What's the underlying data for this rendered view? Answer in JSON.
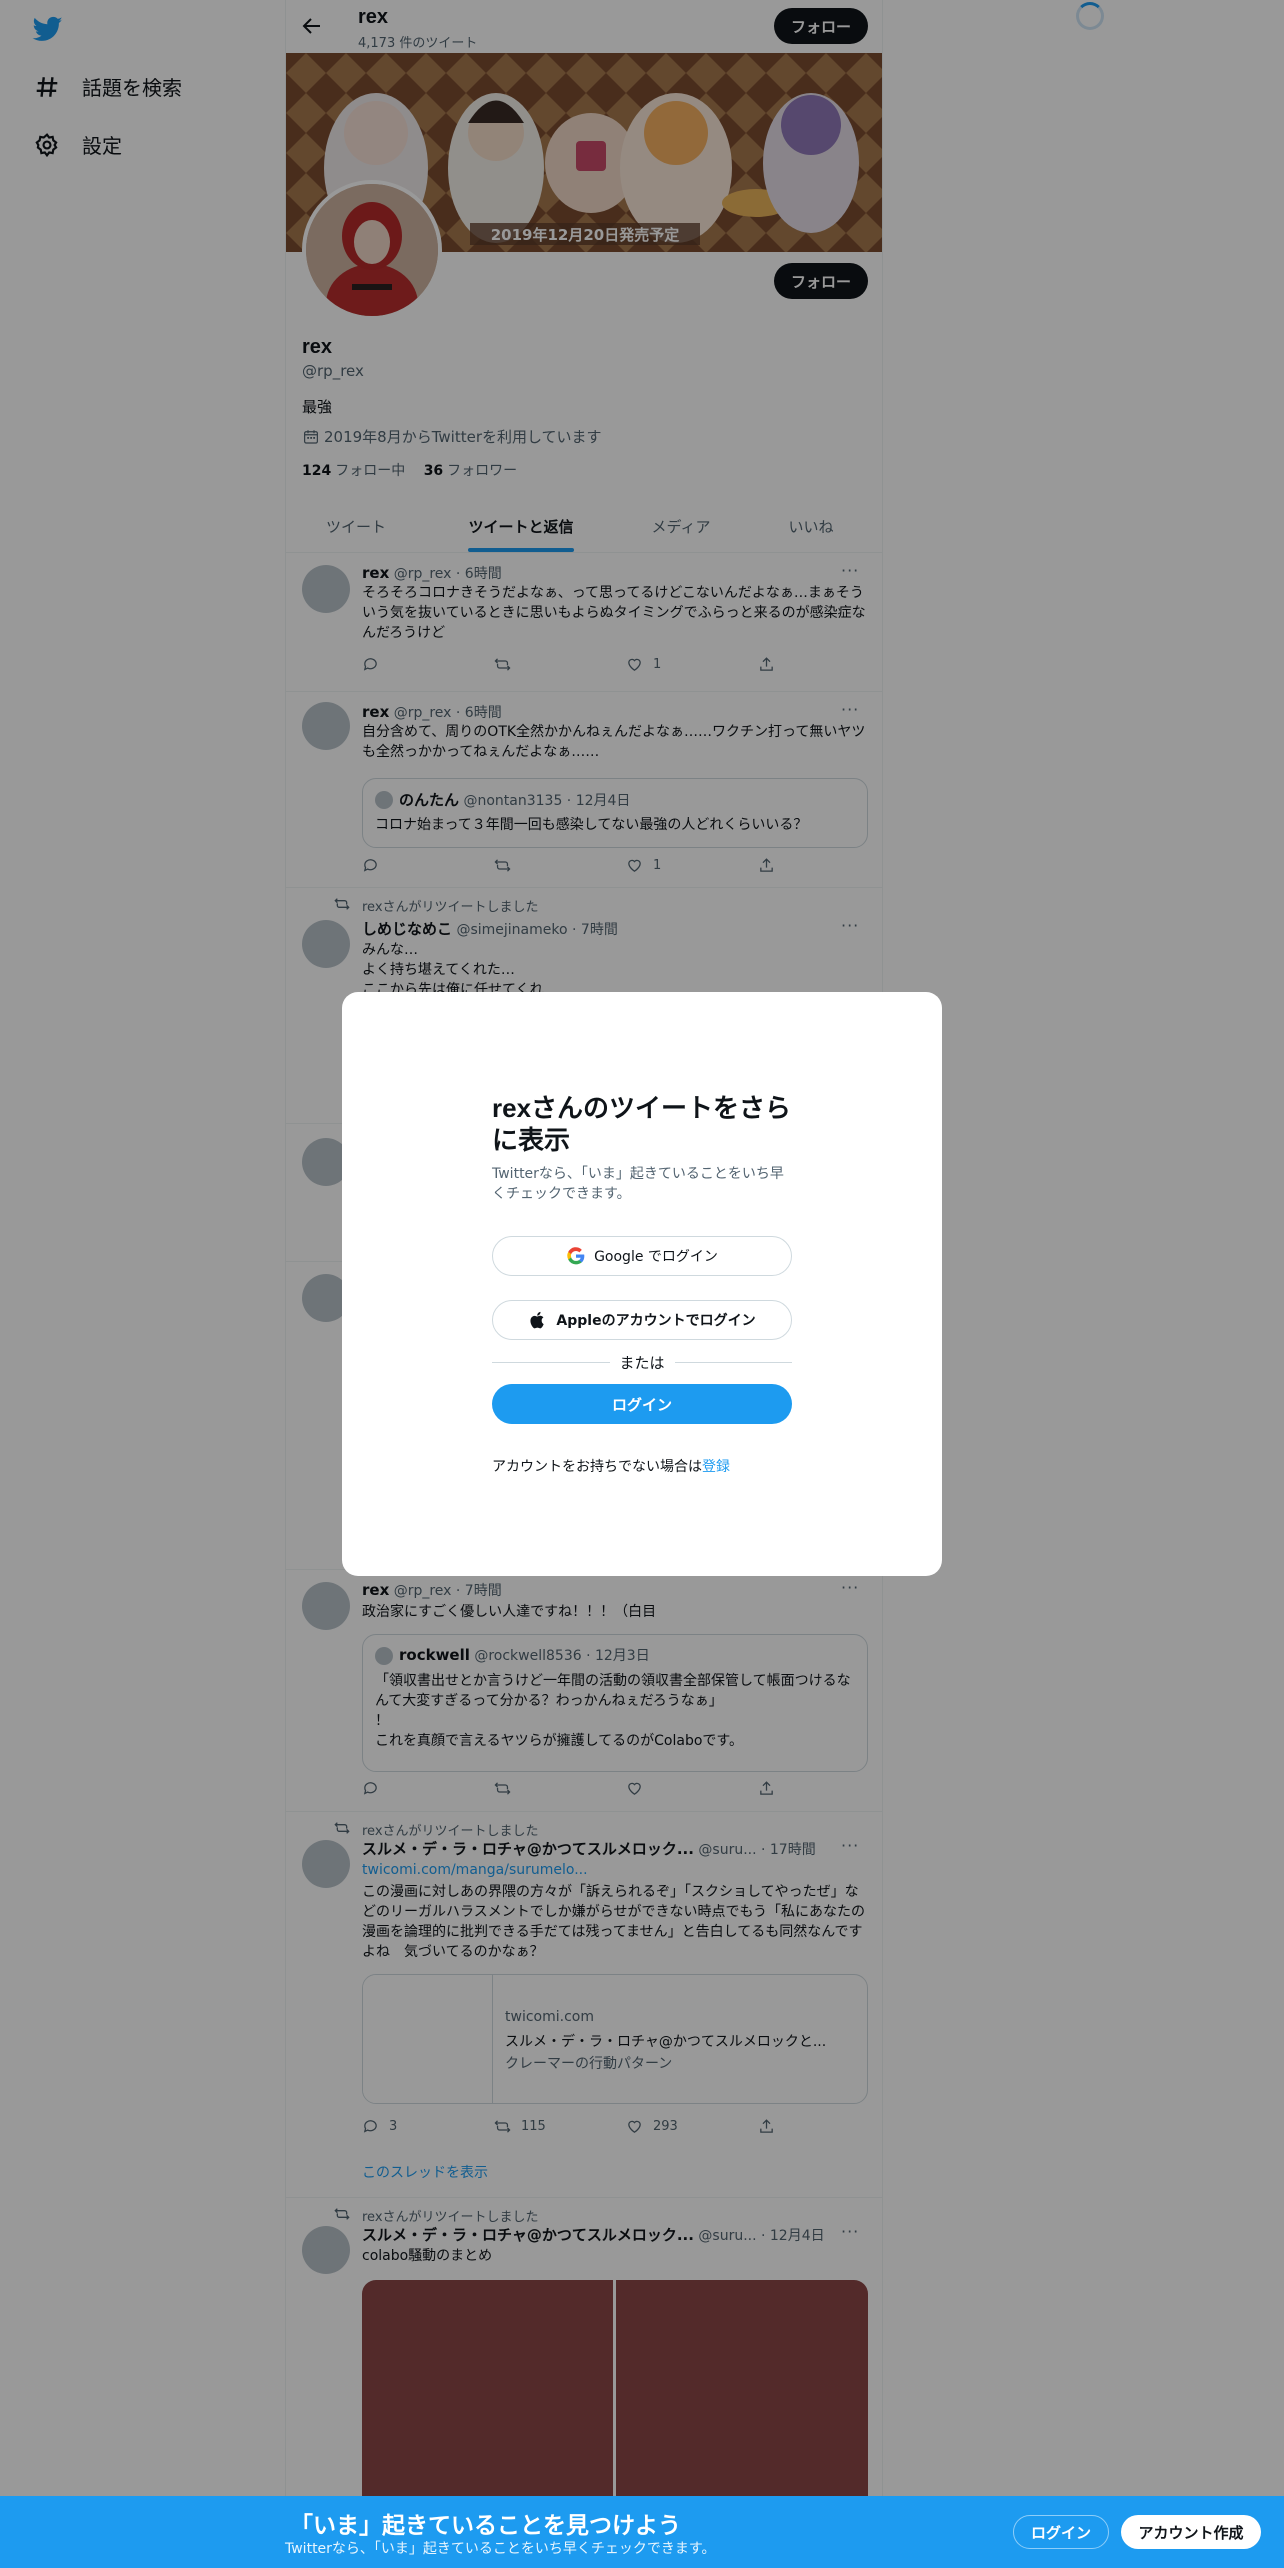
{
  "nav": {
    "explore_label": "話題を検索",
    "settings_label": "設定"
  },
  "header": {
    "title": "rex",
    "tweet_count": "4,173 件のツイート",
    "follow_label": "フォロー"
  },
  "banner": {
    "caption": "2019年12月20日発売予定"
  },
  "profile": {
    "name": "rex",
    "handle": "@rp_rex",
    "bio": "最強",
    "joined": "2019年8月からTwitterを利用しています",
    "following_count": "124",
    "following_label": "フォロー中",
    "followers_count": "36",
    "followers_label": "フォロワー",
    "follow_label": "フォロー"
  },
  "tabs": [
    "ツイート",
    "ツイートと返信",
    "メディア",
    "いいね"
  ],
  "tweets": [
    {
      "name": "rex",
      "meta": "@rp_rex · 6時間",
      "text": "そろそろコロナきそうだよなぁ、って思ってるけどこないんだよなぁ…まぁそういう気を抜いているときに思いもよらぬタイミングでふらっと来るのが感染症なんだろうけど",
      "reply": "",
      "retweet": "",
      "like": "1"
    },
    {
      "name": "rex",
      "meta": "@rp_rex · 6時間",
      "text": "自分含めて、周りのOTK全然かかんねぇんだよなぁ……ワクチン打って無いヤツも全然っかかってねぇんだよなぁ……",
      "quote": {
        "name": "のんたん",
        "meta": "@nontan3135 · 12月4日",
        "text": "コロナ始まって３年間一回も感染してない最強の人どれくらいいる？"
      },
      "reply": "",
      "retweet": "",
      "like": "1"
    },
    {
      "retweet_label": "rexさんがリツイートしました",
      "name": "しめじなめこ",
      "meta": "@simejinameko · 7時間",
      "text": "みんな…\nよく持ち堪えてくれた…\nここから先は俺に任せてくれ"
    },
    {
      "name": "rex",
      "meta": "@rp_rex · 7時間",
      "text": "政治家にすごく優しい人達ですね！！！（白目",
      "quote": {
        "name": "rockwell",
        "meta": "@rockwell8536 · 12月3日",
        "text": "「領収書出せとか言うけど一年間の活動の領収書全部保管して帳面つけるなんて大変すぎるって分かる？わっかんねぇだろうなぁ」\n！\nこれを真顔で言えるヤツらが擁護してるのがColaboです。"
      },
      "reply": "",
      "retweet": "",
      "like": ""
    },
    {
      "retweet_label": "rexさんがリツイートしました",
      "name": "スルメ・デ・ラ・ロチャ@かつてスルメロック...",
      "meta": "@suru... · 17時間",
      "link": "twicomi.com/manga/surumelo...",
      "text": "この漫画に対しあの界隈の方々が「訴えられるぞ」「スクショしてやったぜ」などのリーガルハラスメントでしか嫌がらせができない時点でもう「私にあなたの漫画を論理的に批判できる手だては残ってません」と告白してるも同然なんですよね　気づいてるのかなぁ？",
      "card": {
        "domain": "twicomi.com",
        "title": "スルメ・デ・ラ・ロチャ@かつてスルメロックと...",
        "desc": "クレーマーの行動パターン"
      },
      "reply": "3",
      "retweet": "115",
      "like": "293",
      "thread_label": "このスレッドを表示"
    },
    {
      "retweet_label": "rexさんがリツイートしました",
      "name": "スルメ・デ・ラ・ロチャ@かつてスルメロック...",
      "meta": "@suru... · 12月4日",
      "text": "colabo騒動のまとめ"
    }
  ],
  "modal": {
    "title": "rexさんのツイートをさらに表示",
    "subtitle": "Twitterなら、「いま」起きていることをいち早くチェックできます。",
    "google_label": "Google でログイン",
    "apple_label": "Appleのアカウントでログイン",
    "or_label": "または",
    "login_label": "ログイン",
    "signup_prompt": "アカウントをお持ちでない場合は",
    "signup_link": "登録"
  },
  "bottom_bar": {
    "title": "「いま」起きていることを見つけよう",
    "subtitle": "Twitterなら、「いま」起きていることをいち早くチェックできます。",
    "login_label": "ログイン",
    "signup_label": "アカウント作成"
  },
  "colors": {
    "accent": "#1d9bf0",
    "text": "#0f1419",
    "muted": "#536471"
  }
}
